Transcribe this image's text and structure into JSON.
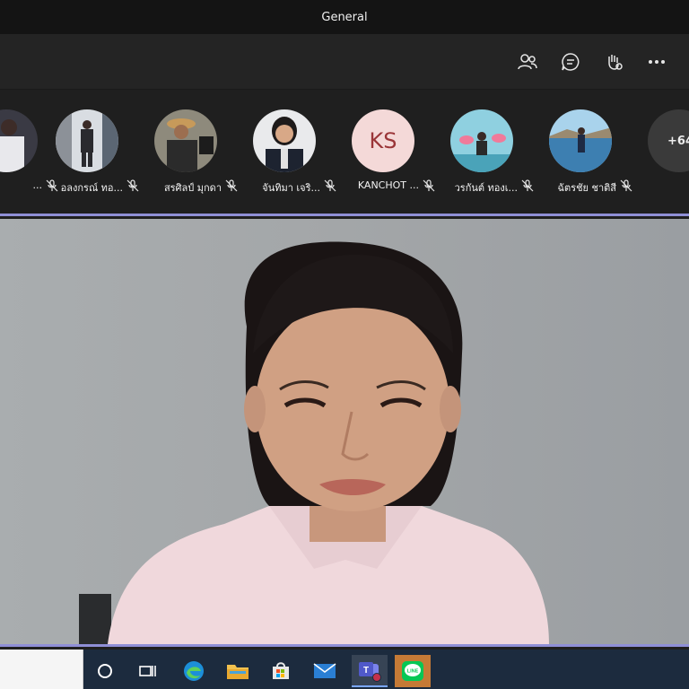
{
  "window": {
    "title": "General"
  },
  "toolbar": {
    "icons": [
      "people-icon",
      "chat-icon",
      "raise-hand-icon",
      "more-options-icon"
    ]
  },
  "participants": [
    {
      "name": "...",
      "muted": true
    },
    {
      "name": "อลงกรณ์ ทอ...",
      "muted": true
    },
    {
      "name": "สรศิลป์ มุกดา",
      "muted": true
    },
    {
      "name": "จันทิมา เจริ...",
      "muted": true
    },
    {
      "name": "KANCHOT ...",
      "initials": "KS",
      "muted": true
    },
    {
      "name": "วรกันต์ ทองเ...",
      "muted": true
    },
    {
      "name": "ฉัตรชัย ชาติสี",
      "muted": true
    }
  ],
  "more_participants": "+64",
  "taskbar": {
    "apps": [
      "cortana-icon",
      "task-view-icon",
      "edge-icon",
      "file-explorer-icon",
      "store-icon",
      "mail-icon",
      "teams-icon",
      "line-icon"
    ]
  },
  "colors": {
    "accent_line": "#8f8fd6",
    "taskbar": "#1c2b3e"
  }
}
